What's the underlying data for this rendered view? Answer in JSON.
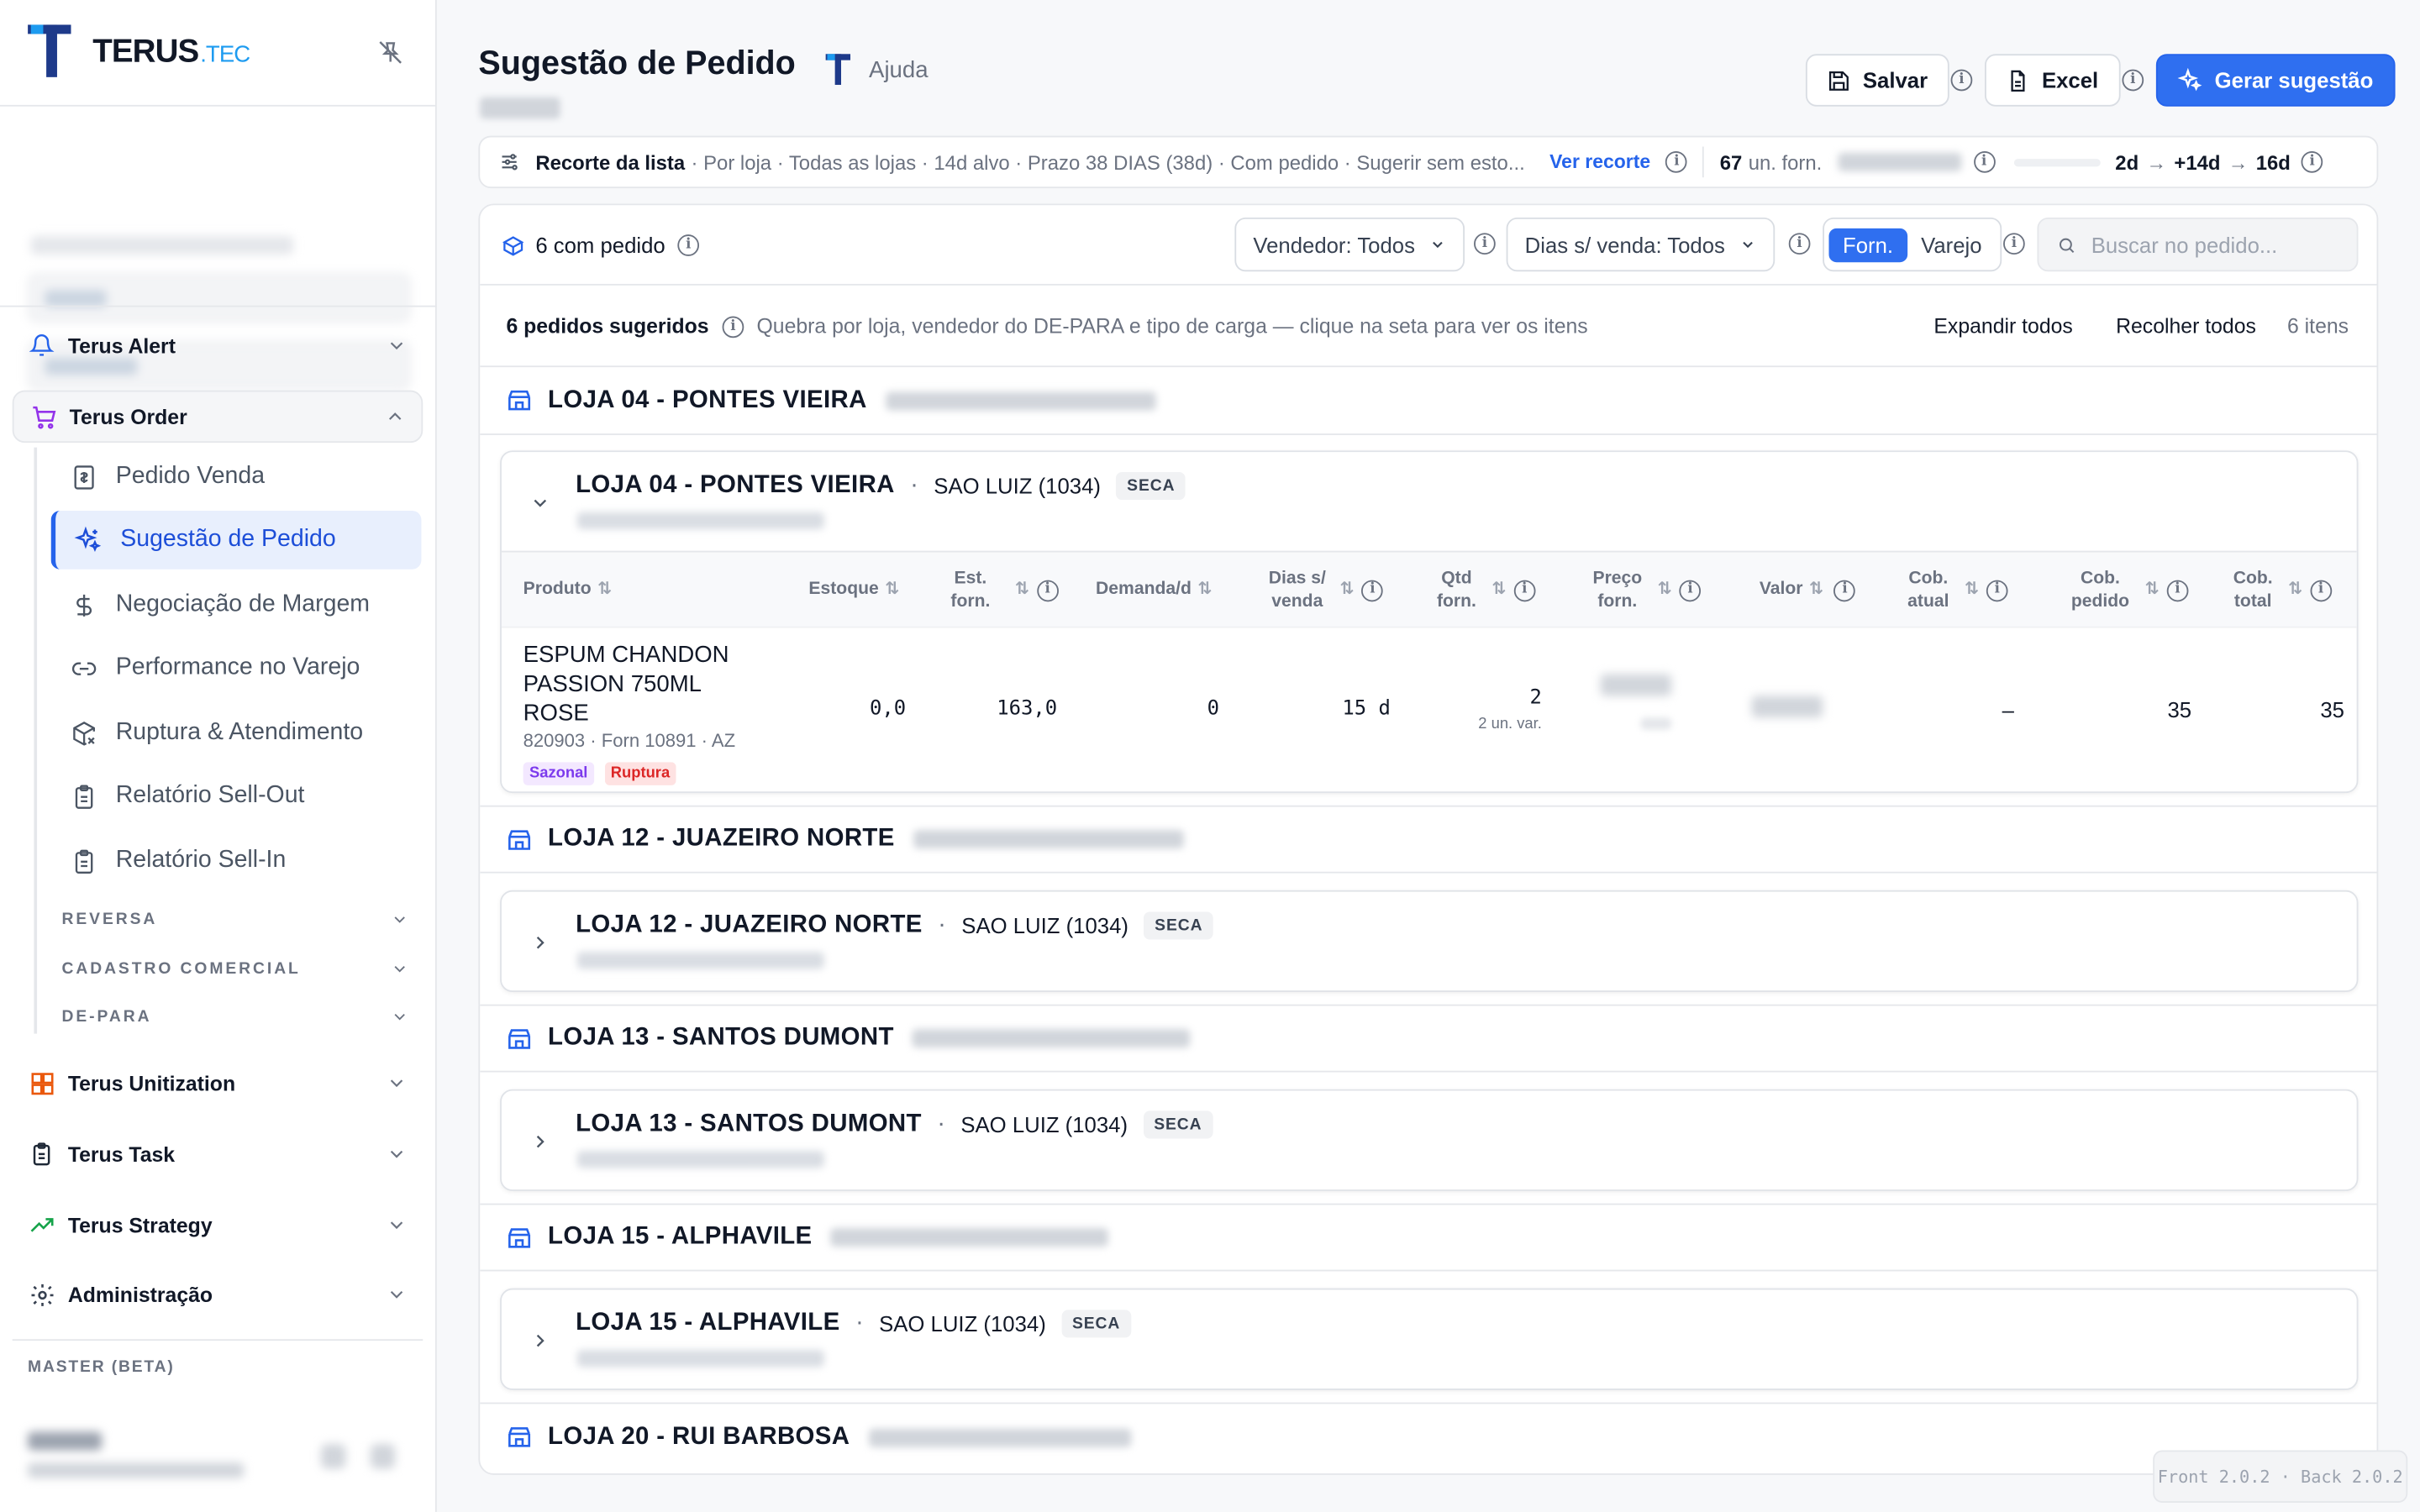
{
  "app": {
    "logo_main": "TERUS",
    "logo_suffix": ".TEC",
    "version_text": "Front 2.0.2 · Back 2.0.2"
  },
  "sidebar": {
    "groups": [
      {
        "label": "Terus Alert",
        "icon": "bell-icon"
      },
      {
        "label": "Terus Order",
        "icon": "cart-icon",
        "expanded": true
      },
      {
        "label": "Terus Unitization",
        "icon": "grid-icon"
      },
      {
        "label": "Terus Task",
        "icon": "clipboard-icon"
      },
      {
        "label": "Terus Strategy",
        "icon": "trending-up-icon"
      },
      {
        "label": "Administração",
        "icon": "gear-icon"
      }
    ],
    "order_items": [
      {
        "label": "Pedido Venda",
        "icon": "receipt-icon"
      },
      {
        "label": "Sugestão de Pedido",
        "icon": "sparkles-icon",
        "active": true
      },
      {
        "label": "Negociação de Margem",
        "icon": "dollar-icon"
      },
      {
        "label": "Performance no Varejo",
        "icon": "link-icon"
      },
      {
        "label": "Ruptura & Atendimento",
        "icon": "package-x-icon"
      },
      {
        "label": "Relatório Sell-Out",
        "icon": "clipboard-icon"
      },
      {
        "label": "Relatório Sell-In",
        "icon": "clipboard-icon"
      }
    ],
    "order_sections": [
      "REVERSA",
      "CADASTRO COMERCIAL",
      "DE-PARA"
    ],
    "footer_label": "MASTER (BETA)"
  },
  "header": {
    "title": "Sugestão de Pedido",
    "help_label": "Ajuda",
    "save_label": "Salvar",
    "excel_label": "Excel",
    "generate_label": "Gerar sugestão"
  },
  "recorte": {
    "title": "Recorte da lista",
    "description": "· Por loja · Todas as lojas · 14d alvo · Prazo 38 DIAS (38d) · Com pedido · Sugerir sem esto...",
    "link_label": "Ver recorte",
    "units_value": "67",
    "units_label": "un. forn.",
    "days_from": "2d",
    "days_add": "+14d",
    "days_to": "16d"
  },
  "toolbar": {
    "com_pedido": "6 com pedido",
    "vendor_select": "Vendedor: Todos",
    "days_select": "Dias s/ venda: Todos",
    "seg_forn": "Forn.",
    "seg_varejo": "Varejo",
    "search_placeholder": "Buscar no pedido..."
  },
  "summary": {
    "count_label": "6 pedidos sugeridos",
    "description": "Quebra por loja, vendedor do DE-PARA e tipo de carga — clique na seta para ver os itens",
    "expand_all": "Expandir todos",
    "collapse_all": "Recolher todos",
    "items_count": "6 itens"
  },
  "stores": [
    {
      "name": "LOJA 04 - PONTES VIEIRA",
      "buyer": "SAO LUIZ (1034)",
      "tag": "SECA",
      "expanded": true
    },
    {
      "name": "LOJA 12 - JUAZEIRO NORTE",
      "buyer": "SAO LUIZ (1034)",
      "tag": "SECA"
    },
    {
      "name": "LOJA 13 - SANTOS DUMONT",
      "buyer": "SAO LUIZ (1034)",
      "tag": "SECA"
    },
    {
      "name": "LOJA 15 - ALPHAVILE",
      "buyer": "SAO LUIZ (1034)",
      "tag": "SECA"
    },
    {
      "name": "LOJA 20 - RUI BARBOSA"
    }
  ],
  "table": {
    "headers": {
      "produto": "Produto",
      "estoque": "Estoque",
      "est_forn_1": "Est.",
      "est_forn_2": "forn.",
      "demanda": "Demanda/d",
      "dias_1": "Dias s/",
      "dias_2": "venda",
      "qtd_1": "Qtd",
      "qtd_2": "forn.",
      "preco_1": "Preço",
      "preco_2": "forn.",
      "valor": "Valor",
      "cob_atual_1": "Cob.",
      "cob_atual_2": "atual",
      "cob_pedido_1": "Cob.",
      "cob_pedido_2": "pedido",
      "cob_total_1": "Cob.",
      "cob_total_2": "total"
    },
    "row": {
      "product_l1": "ESPUM CHANDON",
      "product_l2": "PASSION 750ML",
      "product_l3": "ROSE",
      "product_meta": "820903 · Forn 10891 · AZ",
      "badge_1": "Sazonal",
      "badge_2": "Ruptura",
      "estoque": "0,0",
      "est_forn": "163,0",
      "demanda": "0",
      "dias": "15 d",
      "qtd": "2",
      "qtd_sub": "2 un. var.",
      "cob_atual": "–",
      "cob_pedido": "35",
      "cob_total": "35"
    }
  },
  "colors": {
    "accent": "#2f6ff0",
    "active_bg": "#e8effd",
    "badge_sazonal": "#7c3aed",
    "badge_ruptura": "#dc2626"
  }
}
